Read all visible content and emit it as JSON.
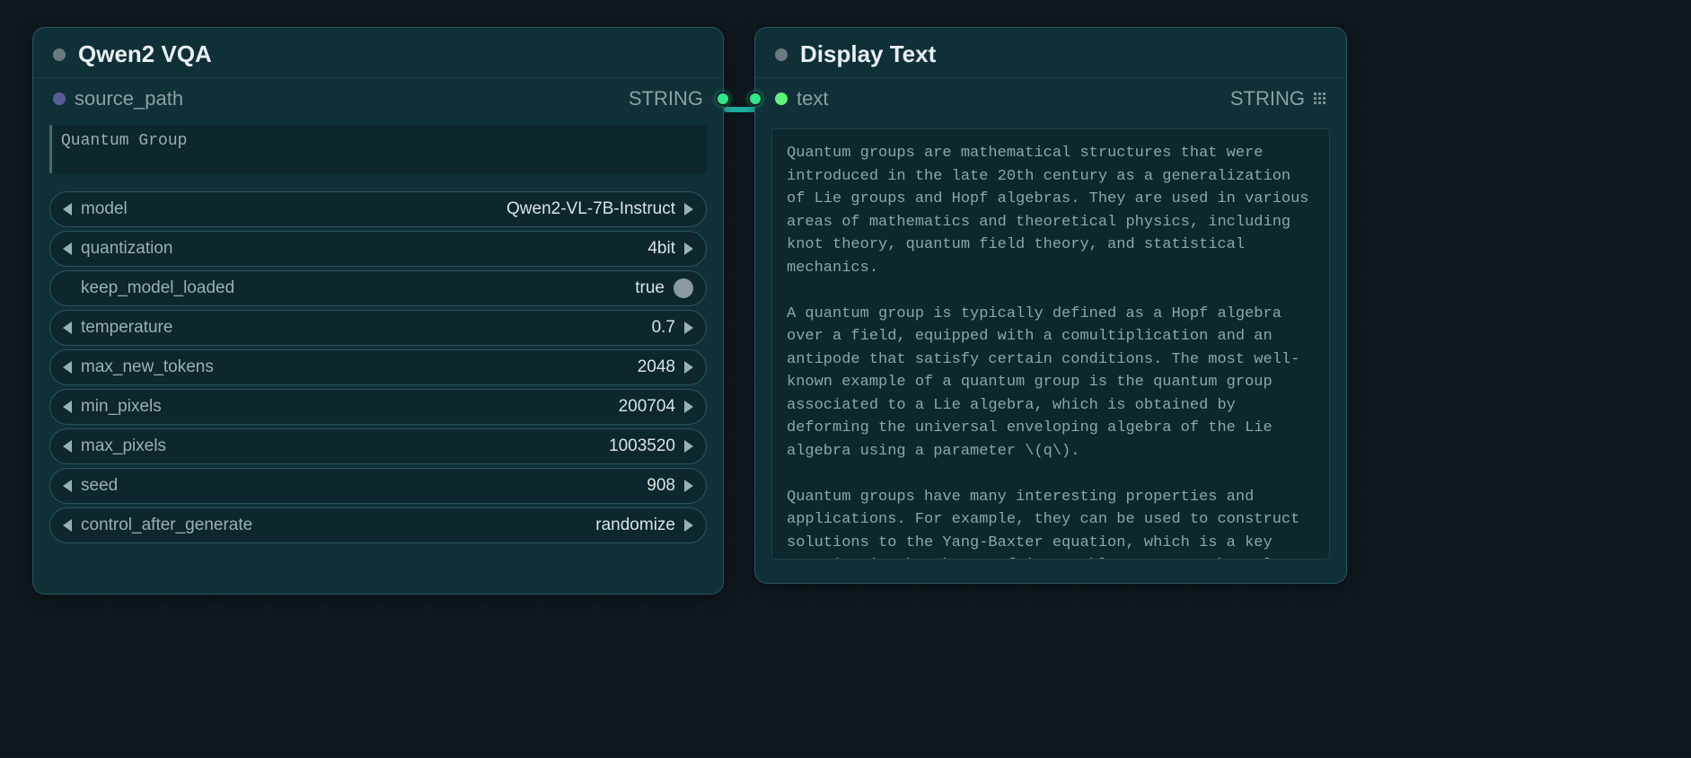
{
  "nodeA": {
    "title": "Qwen2 VQA",
    "input_label": "source_path",
    "output_type": "STRING",
    "prompt": "Quantum Group",
    "widgets": {
      "model": {
        "label": "model",
        "value": "Qwen2-VL-7B-Instruct"
      },
      "quantization": {
        "label": "quantization",
        "value": "4bit"
      },
      "keep_loaded": {
        "label": "keep_model_loaded",
        "value": "true"
      },
      "temperature": {
        "label": "temperature",
        "value": "0.7"
      },
      "max_tokens": {
        "label": "max_new_tokens",
        "value": "2048"
      },
      "min_pixels": {
        "label": "min_pixels",
        "value": "200704"
      },
      "max_pixels": {
        "label": "max_pixels",
        "value": "1003520"
      },
      "seed": {
        "label": "seed",
        "value": "908"
      },
      "cag": {
        "label": "control_after_generate",
        "value": "randomize"
      }
    }
  },
  "nodeB": {
    "title": "Display Text",
    "input_label": "text",
    "output_type": "STRING",
    "content": "Quantum groups are mathematical structures that were introduced in the late 20th century as a generalization of Lie groups and Hopf algebras. They are used in various areas of mathematics and theoretical physics, including knot theory, quantum field theory, and statistical mechanics.\n\nA quantum group is typically defined as a Hopf algebra over a field, equipped with a comultiplication and an antipode that satisfy certain conditions. The most well-known example of a quantum group is the quantum group associated to a Lie algebra, which is obtained by deforming the universal enveloping algebra of the Lie algebra using a parameter \\(q\\).\n\nQuantum groups have many interesting properties and applications. For example, they can be used to construct solutions to the Yang-Baxter equation, which is a key equation in the theory of integrable systems. They also play a role in the study of quantum field theories and the classification of topological phases of matter."
  }
}
